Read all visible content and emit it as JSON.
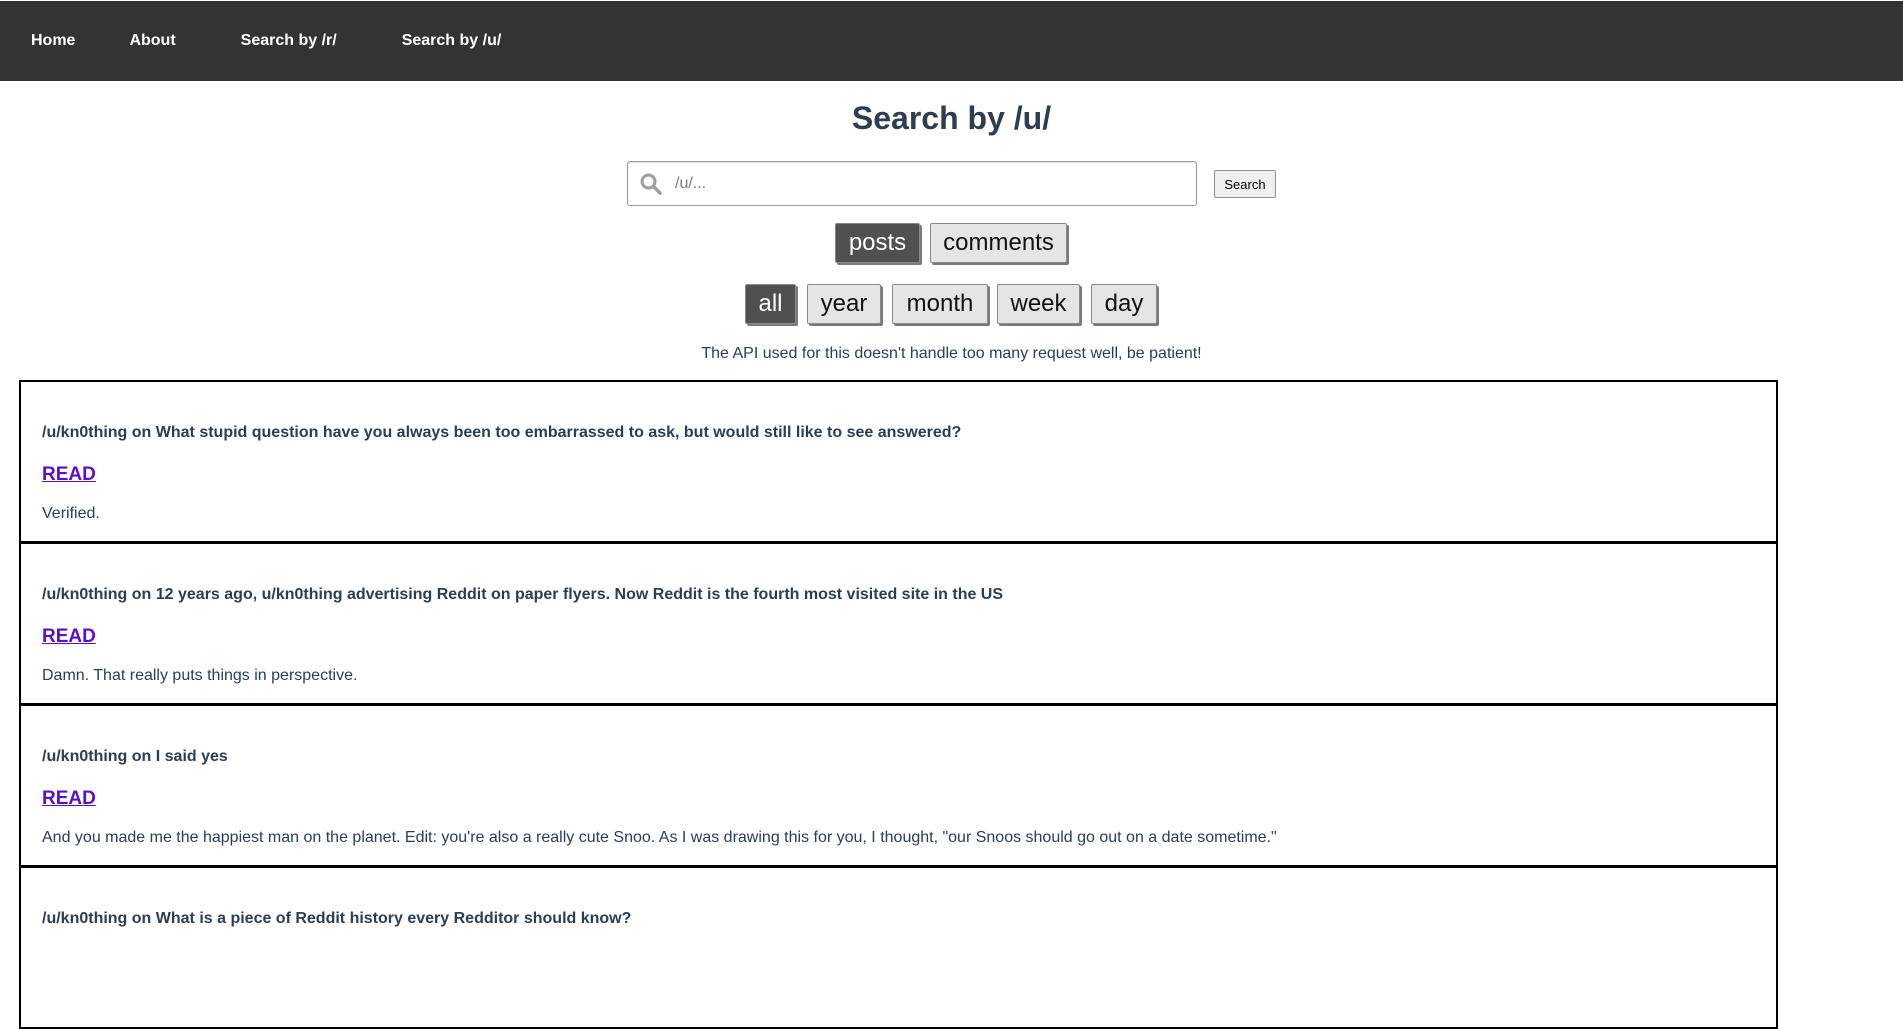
{
  "nav": {
    "items": [
      "Home",
      "About",
      "Search by /r/",
      "Search by /u/"
    ]
  },
  "page": {
    "title": "Search by /u/",
    "notice": "The API used for this doesn't handle too many request well, be patient!"
  },
  "search": {
    "placeholder": "/u/...",
    "value": "",
    "button_label": "Search",
    "icon": "magnifier-icon"
  },
  "type_toggle": {
    "options": [
      "posts",
      "comments"
    ],
    "selected": "posts"
  },
  "time_filter": {
    "options": [
      "all",
      "year",
      "month",
      "week",
      "day"
    ],
    "selected": "all"
  },
  "results": [
    {
      "title": "/u/kn0thing on What stupid question have you always been too embarrassed to ask, but would still like to see answered?",
      "link_label": "READ",
      "body": "Verified."
    },
    {
      "title": "/u/kn0thing on 12 years ago, u/kn0thing advertising Reddit on paper flyers. Now Reddit is the fourth most visited site in the US",
      "link_label": "READ",
      "body": "Damn. That really puts things in perspective."
    },
    {
      "title": "/u/kn0thing on I said yes",
      "link_label": "READ",
      "body": "And you made me the happiest man on the planet. Edit: you're also a really cute Snoo. As I was drawing this for you, I thought, \"our Snoos should go out on a date sometime.\""
    },
    {
      "title": "/u/kn0thing on What is a piece of Reddit history every Redditor should know?",
      "link_label": "",
      "body": ""
    }
  ],
  "colors": {
    "nav_bg": "#333333",
    "text": "#2c3e50",
    "link": "#5a0fcf",
    "active_toggle": "#505050"
  }
}
